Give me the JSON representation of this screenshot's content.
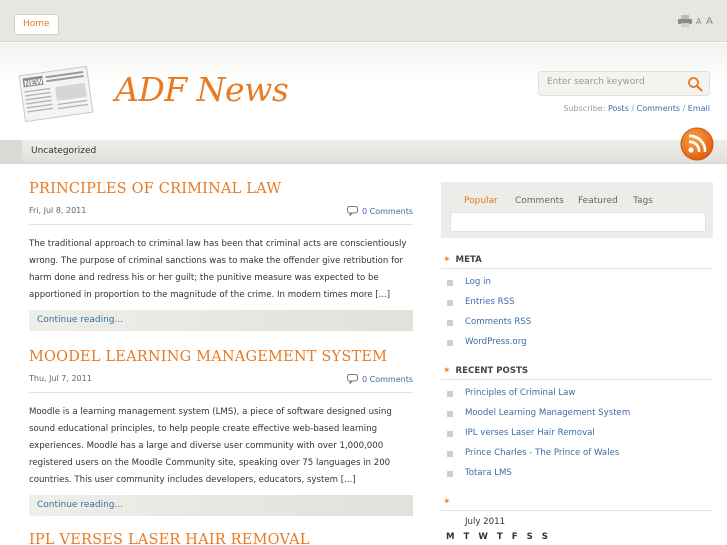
{
  "topbar": {
    "home_label": "Home",
    "font_small": "A",
    "font_large": "A"
  },
  "header": {
    "title": "ADF News",
    "logo_text": "NEWS",
    "search_placeholder": "Enter search keyword"
  },
  "subscribe": {
    "prefix": "Subscribe:",
    "posts": "Posts",
    "sep1": " / ",
    "comments": "Comments",
    "sep2": " / ",
    "email": "Email"
  },
  "nav": {
    "category": "Uncategorized"
  },
  "posts": [
    {
      "title": "Principles of Criminal Law",
      "date": "Fri, Jul 8, 2011",
      "comments": "0 Comments",
      "excerpt": "The traditional approach to criminal law has been that criminal acts are conscientiously wrong. The purpose of criminal sanctions was to make the offender give retribution for harm done and redress his or her guilt; the punitive measure was expected to be apportioned in proportion to the magnitude of the crime. In modern times more [...]",
      "continue": "Continue reading..."
    },
    {
      "title": "Moodel Learning Management System",
      "date": "Thu, Jul 7, 2011",
      "comments": "0 Comments",
      "excerpt": "Moodle is a learning management system (LMS), a piece of software designed using sound educational principles, to help people create effective web-based learning experiences. Moodle has a large and diverse user community with over 1,000,000 registered users on the Moodle Community site, speaking over 75 languages in 200 countries. This user community includes developers, educators, system [...]",
      "continue": "Continue reading..."
    },
    {
      "title": "IPL verses Laser Hair Removal"
    }
  ],
  "sidebar": {
    "tabs": [
      "Popular",
      "Comments",
      "Featured",
      "Tags"
    ],
    "meta": {
      "heading": "META",
      "items": [
        "Log in",
        "Entries RSS",
        "Comments RSS",
        "WordPress.org"
      ]
    },
    "recent": {
      "heading": "RECENT POSTS",
      "items": [
        "Principles of Criminal Law",
        "Moodel Learning Management System",
        "IPL verses Laser Hair Removal",
        "Prince Charles - The Prince of Wales",
        "Totara LMS"
      ]
    },
    "calendar": {
      "month": "July 2011",
      "days": "M T W T F S S"
    }
  },
  "colors": {
    "accent": "#e87a22",
    "link": "#3a6ea5",
    "bar": "#e7e7e2"
  }
}
